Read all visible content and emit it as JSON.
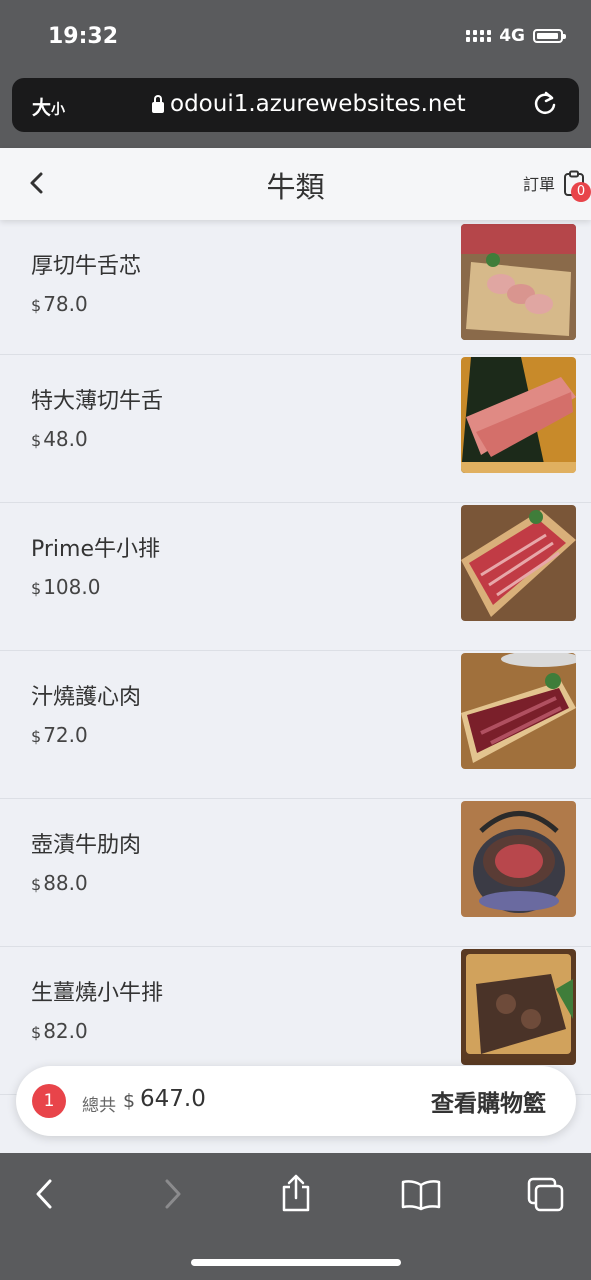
{
  "status_bar": {
    "time": "19:32",
    "network": "4G"
  },
  "browser": {
    "text_size_label": "大",
    "text_size_small": "小",
    "url": "odoui1.azurewebsites.net"
  },
  "header": {
    "title": "牛類",
    "orders_label": "訂單",
    "orders_badge": "0"
  },
  "items": [
    {
      "name": "厚切牛舌芯",
      "currency": "$",
      "price": "78.0",
      "image": "sliced-beef-tongue-on-wooden-board"
    },
    {
      "name": "特大薄切牛舌",
      "currency": "$",
      "price": "48.0",
      "image": "thin-sliced-beef-tongue-on-leaf"
    },
    {
      "name": "Prime牛小排",
      "currency": "$",
      "price": "108.0",
      "image": "prime-short-rib-slices-on-board"
    },
    {
      "name": "汁燒護心肉",
      "currency": "$",
      "price": "72.0",
      "image": "marinated-beef-slices-on-board"
    },
    {
      "name": "壺漬牛肋肉",
      "currency": "$",
      "price": "88.0",
      "image": "beef-rib-in-clay-pot"
    },
    {
      "name": "生薑燒小牛排",
      "currency": "$",
      "price": "82.0",
      "image": "ginger-short-rib-on-tray"
    }
  ],
  "cart": {
    "count": "1",
    "total_label": "總共",
    "currency": "$",
    "total": "647.0",
    "view_label": "查看購物籃"
  },
  "colors": {
    "accent_red": "#e8444a",
    "chrome_gray": "#5a5b5d",
    "page_bg": "#eef0f5"
  }
}
